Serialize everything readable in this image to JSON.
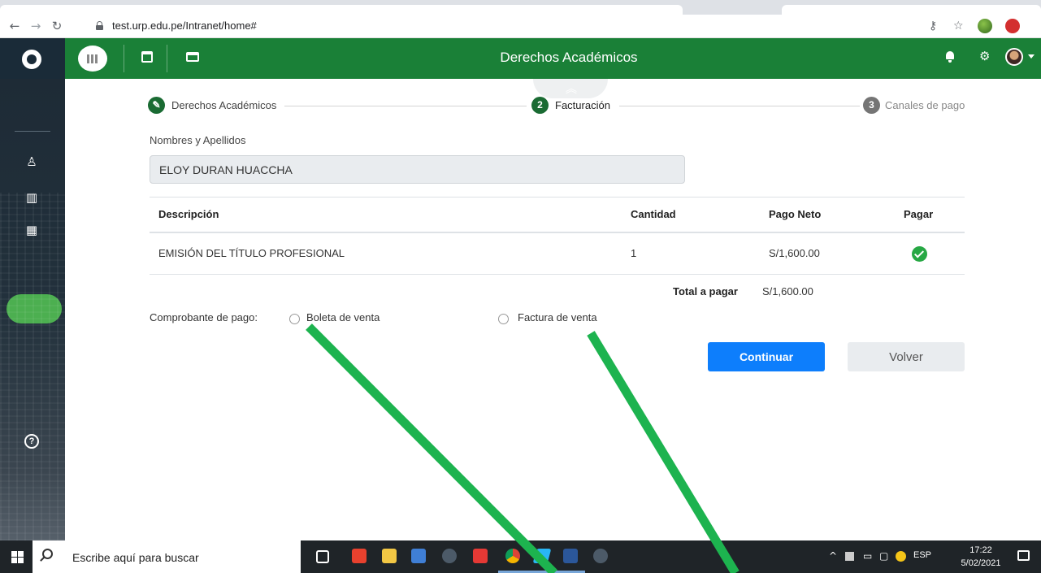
{
  "browser": {
    "url": "test.urp.edu.pe/Intranet/home#",
    "icons": [
      "back-icon",
      "forward-icon",
      "reload-icon",
      "lock-icon",
      "key-icon",
      "star-icon"
    ]
  },
  "header": {
    "title": "Derechos Académicos",
    "accent_color": "#1a8037",
    "icons": [
      "calendar-icon",
      "card-icon",
      "bell-icon",
      "gear-icon"
    ]
  },
  "sidebar": {
    "icons": [
      "user-icon",
      "book-icon",
      "grid-icon",
      "help-icon"
    ]
  },
  "stepper": {
    "steps": [
      {
        "number": "",
        "label": "Derechos Académicos",
        "state": "done"
      },
      {
        "number": "2",
        "label": "Facturación",
        "state": "active"
      },
      {
        "number": "3",
        "label": "Canales de pago",
        "state": "pending"
      }
    ]
  },
  "form": {
    "name_label": "Nombres y Apellidos",
    "name_value": "ELOY DURAN HUACCHA"
  },
  "table": {
    "headers": [
      "Descripción",
      "Cantidad",
      "Pago Neto",
      "Pagar"
    ],
    "rows": [
      {
        "descripcion": "EMISIÓN DEL TÍTULO PROFESIONAL",
        "cantidad": "1",
        "pago_neto": "S/1,600.00",
        "pagar": "check-icon"
      }
    ],
    "total_label": "Total a pagar",
    "total_value": "S/1,600.00"
  },
  "comprobante": {
    "label": "Comprobante de pago:",
    "options": [
      "Boleta de venta",
      "Factura de venta"
    ]
  },
  "buttons": {
    "continue": "Continuar",
    "back": "Volver",
    "continue_color": "#0d7efc"
  },
  "taskbar": {
    "search_placeholder": "Escribe aquí para buscar",
    "language": "ESP",
    "time": "17:22",
    "date": "5/02/2021"
  },
  "annotation": {
    "arrow_color": "#1db34f"
  }
}
